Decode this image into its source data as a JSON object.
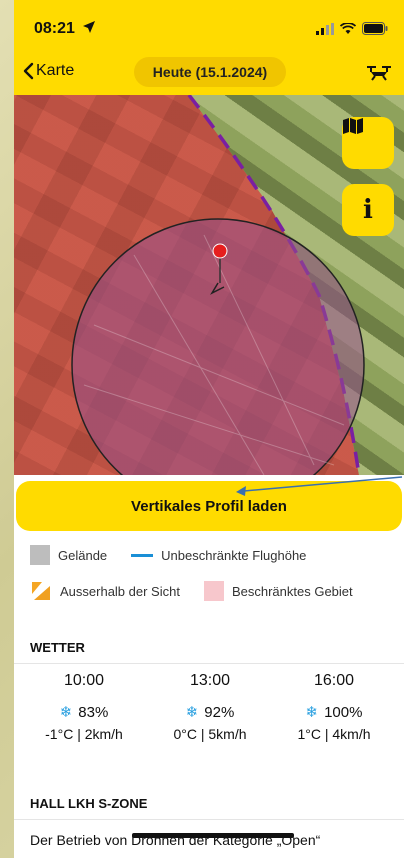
{
  "status_bar": {
    "time": "08:21"
  },
  "header": {
    "back_label": "Karte",
    "date_label": "Heute (15.1.2024)"
  },
  "map": {
    "map_button_icon": "map-icon",
    "info_button_label": "i"
  },
  "profile_button": {
    "label": "Vertikales Profil laden"
  },
  "legend": {
    "terrain": "Gelände",
    "unlimited_altitude": "Unbeschränkte Flughöhe",
    "out_of_sight": "Ausserhalb der Sicht",
    "restricted_area": "Beschränktes Gebiet",
    "colors": {
      "terrain": "#bdbdbd",
      "line": "#1a8fd6",
      "restricted": "#f7c7cc",
      "accent": "#ffdb00"
    }
  },
  "weather": {
    "title": "WETTER",
    "columns": [
      {
        "time": "10:00",
        "humidity": "83%",
        "temp_wind": "-1°C | 2km/h"
      },
      {
        "time": "13:00",
        "humidity": "92%",
        "temp_wind": "0°C | 5km/h"
      },
      {
        "time": "16:00",
        "humidity": "100%",
        "temp_wind": "1°C | 4km/h"
      }
    ]
  },
  "zone": {
    "title": "HALL LKH S-ZONE",
    "text": "Der Betrieb von Drohnen der Kategorie „Open“"
  }
}
